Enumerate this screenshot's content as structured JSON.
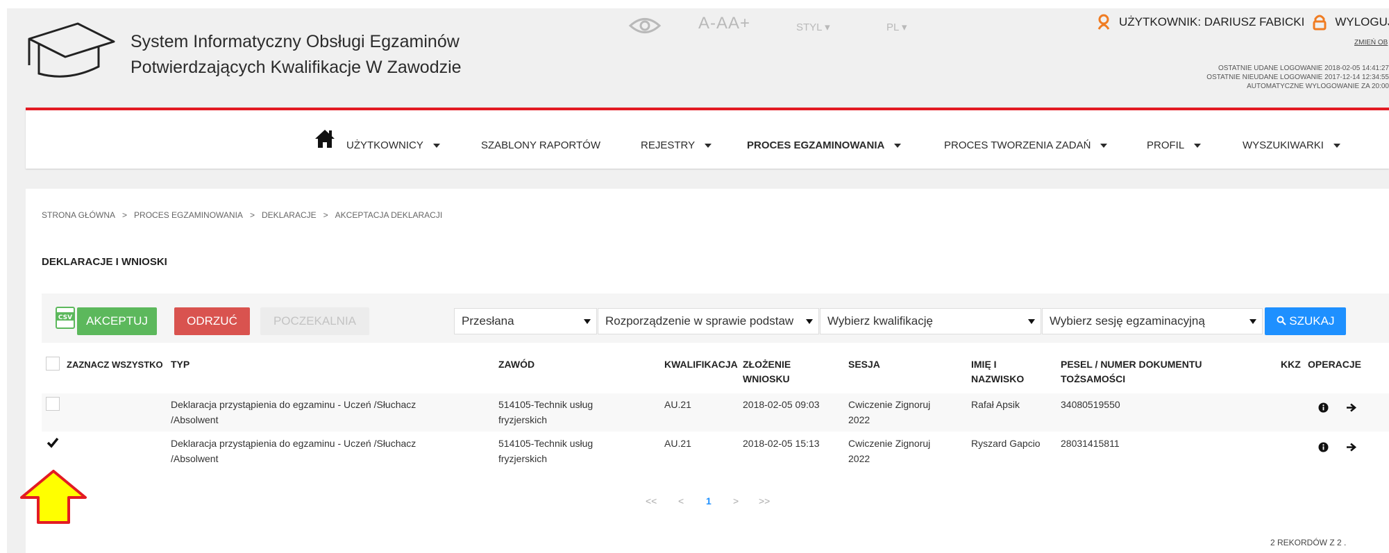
{
  "header": {
    "title_line1": "System Informatyczny Obsługi Egzaminów",
    "title_line2": "Potwierdzających Kwalifikacje W Zawodzie",
    "font_size_label": "A-AA+",
    "style_label": "STYL ▾",
    "lang_label": "PL ▾",
    "user_label": "UŻYTKOWNIK: DARIUSZ FABICKI",
    "logout_label": "WYLOGUJ",
    "change_link": "ZMIEŃ OB",
    "last_login": "OSTATNIE UDANE LOGOWANIE 2018-02-05 14:41:27",
    "last_failed": "OSTATNIE NIEUDANE LOGOWANIE 2017-12-14 12:34:55",
    "auto_logout": "AUTOMATYCZNE WYLOGOWANIE ZA  20:00"
  },
  "nav": {
    "items": [
      {
        "label": "UŻYTKOWNICY"
      },
      {
        "label": "SZABLONY RAPORTÓW"
      },
      {
        "label": "REJESTRY"
      },
      {
        "label": "PROCES EGZAMINOWANIA"
      },
      {
        "label": "PROCES TWORZENIA ZADAŃ"
      },
      {
        "label": "PROFIL"
      },
      {
        "label": "WYSZUKIWARKI"
      }
    ]
  },
  "breadcrumb": [
    "STRONA GŁÓWNA",
    "PROCES EGZAMINOWANIA",
    "DEKLARACJE",
    "AKCEPTACJA DEKLARACJI"
  ],
  "page_title": "DEKLARACJE I WNIOSKI",
  "toolbar": {
    "accept": "AKCEPTUJ",
    "reject": "ODRZUĆ",
    "waiting": "POCZEKALNIA",
    "filter_status": "Przesłana",
    "filter_regulation": "Rozporządzenie w sprawie podstaw",
    "filter_qualification": "Wybierz kwalifikację",
    "filter_session": "Wybierz sesję egzaminacyjną",
    "search": "SZUKAJ"
  },
  "table": {
    "select_all": "ZAZNACZ WSZYSTKO",
    "headers": {
      "typ": "TYP",
      "zawod": "ZAWÓD",
      "kwalifikacja": "KWALIFIKACJA",
      "zlozenie1": "ZŁOŻENIE",
      "zlozenie2": "WNIOSKU",
      "sesja": "SESJA",
      "imie1": "IMIĘ I",
      "imie2": "NAZWISKO",
      "pesel1": "PESEL / NUMER DOKUMENTU",
      "pesel2": "TOŻSAMOŚCI",
      "kkz": "KKZ",
      "operacje": "OPERACJE"
    },
    "rows": [
      {
        "checked": false,
        "typ1": "Deklaracja przystąpienia do egzaminu - Uczeń /Słuchacz",
        "typ2": "/Absolwent",
        "zawod1": "514105-Technik usług",
        "zawod2": "fryzjerskich",
        "kwalifikacja": "AU.21",
        "data": "2018-02-05 09:03",
        "sesja1": "Cwiczenie Zignoruj",
        "sesja2": "2022",
        "osoba": "Rafał Apsik",
        "pesel": "34080519550"
      },
      {
        "checked": true,
        "typ1": "Deklaracja przystąpienia do egzaminu - Uczeń /Słuchacz",
        "typ2": "/Absolwent",
        "zawod1": "514105-Technik usług",
        "zawod2": "fryzjerskich",
        "kwalifikacja": "AU.21",
        "data": "2018-02-05 15:13",
        "sesja1": "Cwiczenie Zignoruj",
        "sesja2": "2022",
        "osoba": "Ryszard Gapcio",
        "pesel": "28031415811"
      }
    ]
  },
  "pagination": {
    "first": "<<",
    "prev": "<",
    "current": "1",
    "next": ">",
    "last": ">>"
  },
  "records": "2  REKORDÓW Z  2  .",
  "colors": {
    "accent_red": "#e31b23",
    "green": "#5cb85c",
    "red": "#d9534f",
    "blue": "#1e90ff",
    "arrow_yellow": "#ffff00"
  }
}
